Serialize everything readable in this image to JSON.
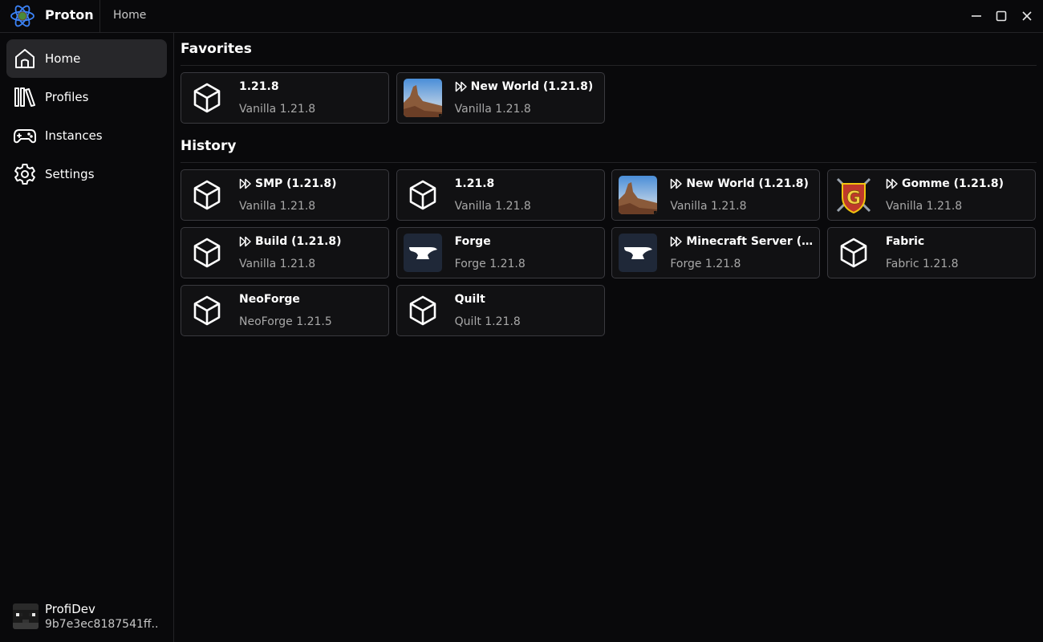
{
  "app": {
    "name": "Proton",
    "breadcrumb": "Home"
  },
  "sidebar": {
    "items": [
      {
        "label": "Home",
        "icon": "home-icon",
        "active": true
      },
      {
        "label": "Profiles",
        "icon": "library-icon"
      },
      {
        "label": "Instances",
        "icon": "gamepad-icon"
      },
      {
        "label": "Settings",
        "icon": "gear-icon"
      }
    ],
    "user": {
      "name": "ProfiDev",
      "id": "9b7e3ec8187541ff.."
    }
  },
  "favorites": {
    "title": "Favorites",
    "cards": [
      {
        "name": "1.21.8",
        "sub": "Vanilla 1.21.8",
        "icon": "cube-icon",
        "server": false
      },
      {
        "name": "New World (1.21.8)",
        "sub": "Vanilla 1.21.8",
        "icon": "world-thumbnail",
        "server": true
      }
    ]
  },
  "history": {
    "title": "History",
    "cards": [
      {
        "name": "SMP (1.21.8)",
        "sub": "Vanilla 1.21.8",
        "icon": "cube-icon",
        "server": true
      },
      {
        "name": "1.21.8",
        "sub": "Vanilla 1.21.8",
        "icon": "cube-icon",
        "server": false
      },
      {
        "name": "New World (1.21.8)",
        "sub": "Vanilla 1.21.8",
        "icon": "world-thumbnail",
        "server": true
      },
      {
        "name": "Gomme (1.21.8)",
        "sub": "Vanilla 1.21.8",
        "icon": "gomme-logo",
        "server": true
      },
      {
        "name": "Build (1.21.8)",
        "sub": "Vanilla 1.21.8",
        "icon": "cube-icon",
        "server": true
      },
      {
        "name": "Forge",
        "sub": "Forge 1.21.8",
        "icon": "anvil-icon",
        "server": false
      },
      {
        "name": "Minecraft Server (Fo…",
        "sub": "Forge 1.21.8",
        "icon": "anvil-icon",
        "server": true
      },
      {
        "name": "Fabric",
        "sub": "Fabric 1.21.8",
        "icon": "cube-icon",
        "server": false
      },
      {
        "name": "NeoForge",
        "sub": "NeoForge 1.21.5",
        "icon": "cube-icon",
        "server": false
      },
      {
        "name": "Quilt",
        "sub": "Quilt 1.21.8",
        "icon": "cube-icon",
        "server": false
      }
    ]
  },
  "colors": {
    "background": "#09090b",
    "card_border": "#3a3a3f",
    "active_nav": "#27272a",
    "accent_logo": "#3b82f6"
  }
}
